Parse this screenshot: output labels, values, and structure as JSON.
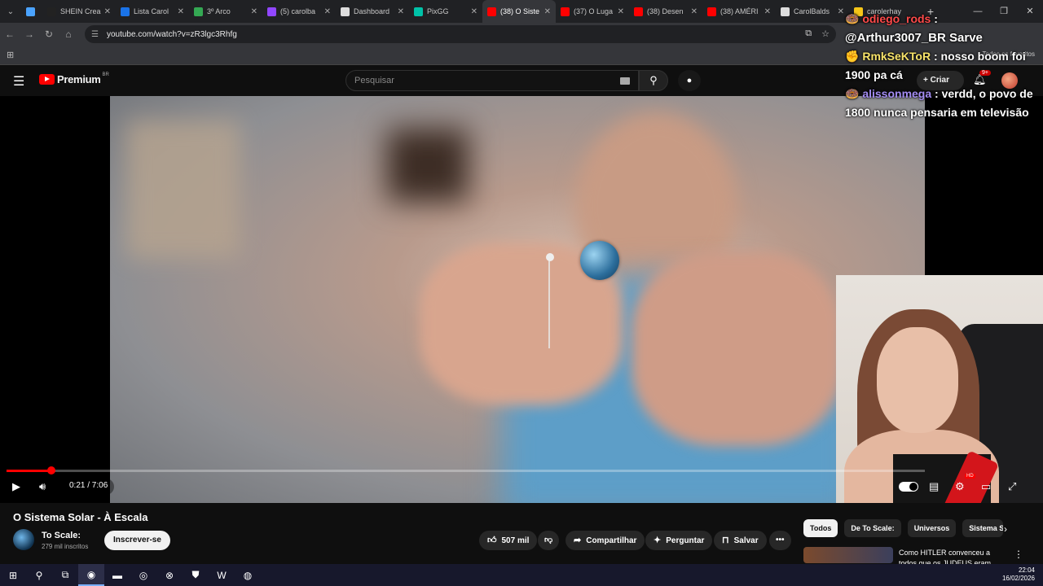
{
  "browser": {
    "tabs": [
      {
        "label": "",
        "color": "#4aa3ff",
        "active": false
      },
      {
        "label": "SHEIN Crea",
        "color": "#222222",
        "active": false
      },
      {
        "label": "Lista Carol",
        "color": "#1a73e8",
        "active": false
      },
      {
        "label": "3º Arco",
        "color": "#34a853",
        "active": false
      },
      {
        "label": "(5) carolba",
        "color": "#9146ff",
        "active": false
      },
      {
        "label": "Dashboard",
        "color": "#dddddd",
        "active": false
      },
      {
        "label": "PixGG",
        "color": "#00c2a8",
        "active": false
      },
      {
        "label": "(38) O Siste",
        "color": "#ff0000",
        "active": true
      },
      {
        "label": "(37) O Luga",
        "color": "#ff0000",
        "active": false
      },
      {
        "label": "(38) Desen",
        "color": "#ff0000",
        "active": false
      },
      {
        "label": "(38) AMÉRI",
        "color": "#ff0000",
        "active": false
      },
      {
        "label": "CarolBalds",
        "color": "#dddddd",
        "active": false
      },
      {
        "label": "carolerhay",
        "color": "#f5c518",
        "active": false
      }
    ],
    "new_tab": "+",
    "url": "youtube.com/watch?v=zR3lgc3Rhfg",
    "bookmarks_label": "Todos os favoritos"
  },
  "youtube": {
    "logo_word": "Premium",
    "logo_region": "BR",
    "search_placeholder": "Pesquisar",
    "create_label": "Criar",
    "notif_count": "9+"
  },
  "chat": [
    {
      "user": "odiego_rods",
      "text": ":",
      "user_color": "red"
    },
    {
      "user": "@Arthur3007_BR",
      "text": "Sarve",
      "user_color": "white"
    },
    {
      "user": "RmkSeKToR",
      "text": ": nosso boom foi 1900 pa cá",
      "user_color": "yellow"
    },
    {
      "user": "alissonmega",
      "text": ": verdd, o povo de 1800 nunca pensaria em televisão",
      "user_color": "purple"
    }
  ],
  "player": {
    "current_time": "0:21",
    "duration": "7:06",
    "time_display": "0:21 / 7:06",
    "progress_fraction": 0.049,
    "hd_badge": "HD"
  },
  "video": {
    "title": "O Sistema Solar - À Escala",
    "channel_name": "To Scale:",
    "subscribers": "279 mil inscritos",
    "subscribe_label": "Inscrever-se",
    "likes": "507 mil",
    "share_label": "Compartilhar",
    "ask_label": "Perguntar",
    "save_label": "Salvar"
  },
  "chips": [
    "Todos",
    "De To Scale:",
    "Universos",
    "Sistema S"
  ],
  "recommended": {
    "title": "Como HITLER convenceu a todos que os JUDEUS eram"
  },
  "taskbar": {
    "time": "22:04",
    "date": "16/02/2026"
  },
  "colors": {
    "accent_red": "#ff0000",
    "background": "#0f0f0f"
  }
}
